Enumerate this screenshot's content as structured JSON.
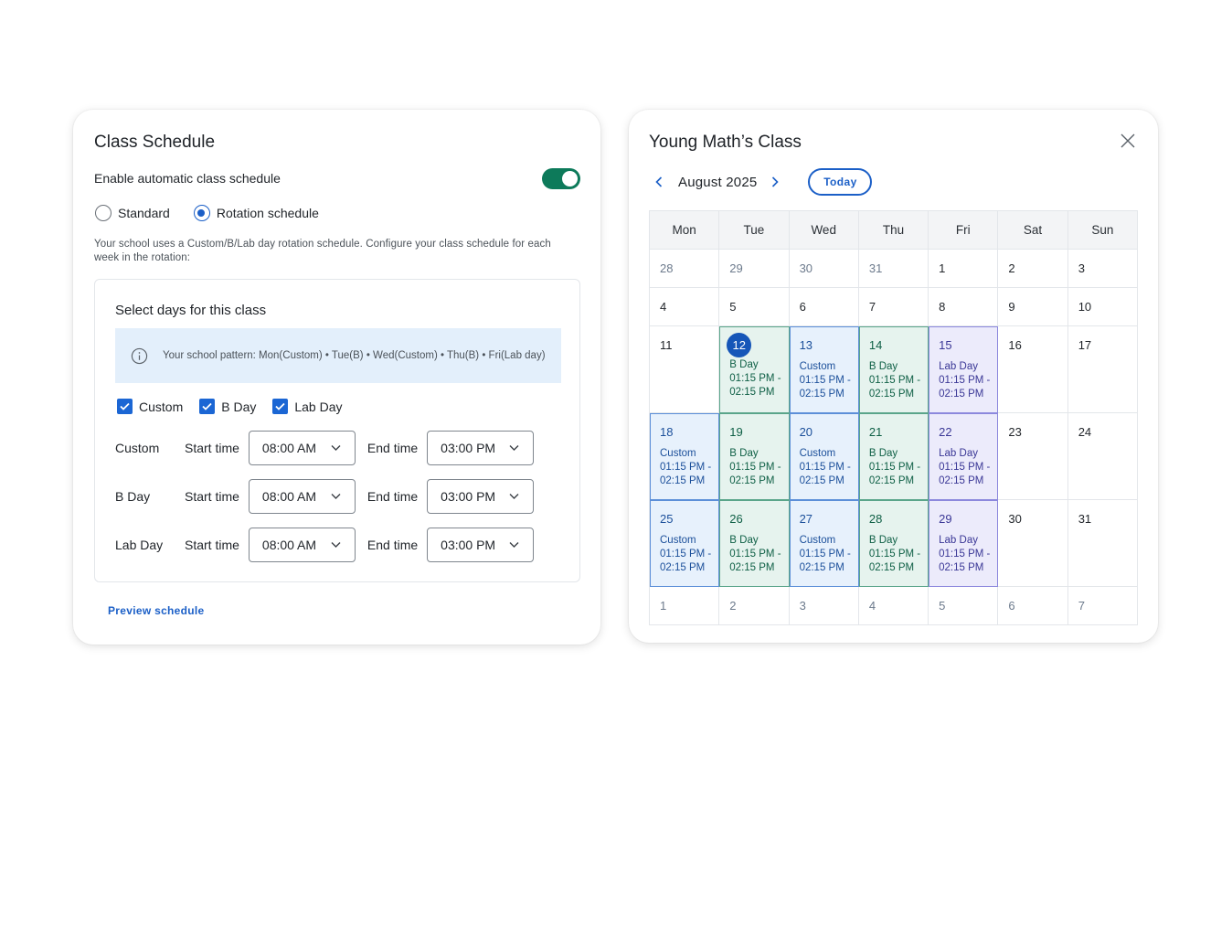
{
  "schedule": {
    "title": "Class Schedule",
    "toggle_label": "Enable automatic class schedule",
    "toggle_on": true,
    "radios": [
      {
        "label": "Standard",
        "checked": false
      },
      {
        "label": "Rotation schedule",
        "checked": true
      }
    ],
    "help_text": "Your school uses a Custom/B/Lab day rotation schedule. Configure your class schedule for each week in the rotation:",
    "panel_title": "Select days for this class",
    "info_text": "Your school pattern: Mon(Custom) • Tue(B) • Wed(Custom) • Thu(B) • Fri(Lab day)",
    "checkboxes": [
      {
        "label": "Custom",
        "checked": true
      },
      {
        "label": "B Day",
        "checked": true
      },
      {
        "label": "Lab Day",
        "checked": true
      }
    ],
    "rows": [
      {
        "day": "Custom",
        "start_label": "Start time",
        "start": "08:00 AM",
        "end_label": "End time",
        "end": "03:00 PM"
      },
      {
        "day": "B Day",
        "start_label": "Start time",
        "start": "08:00 AM",
        "end_label": "End time",
        "end": "03:00 PM"
      },
      {
        "day": "Lab Day",
        "start_label": "Start time",
        "start": "08:00 AM",
        "end_label": "End time",
        "end": "03:00 PM"
      }
    ],
    "preview_link": "Preview schedule"
  },
  "calendar": {
    "title": "Young Math’s Class",
    "month": "August 2025",
    "today_label": "Today",
    "weekdays": [
      "Mon",
      "Tue",
      "Wed",
      "Thu",
      "Fri",
      "Sat",
      "Sun"
    ],
    "weeks": [
      [
        {
          "d": "28",
          "m": true
        },
        {
          "d": "29",
          "m": true
        },
        {
          "d": "30",
          "m": true
        },
        {
          "d": "31",
          "m": true
        },
        {
          "d": "1"
        },
        {
          "d": "2"
        },
        {
          "d": "3"
        }
      ],
      [
        {
          "d": "4"
        },
        {
          "d": "5"
        },
        {
          "d": "6"
        },
        {
          "d": "7"
        },
        {
          "d": "8"
        },
        {
          "d": "9"
        },
        {
          "d": "10"
        }
      ],
      [
        {
          "d": "11"
        },
        {
          "d": "12",
          "t": "bday",
          "today": true,
          "label": "B Day",
          "time": "01:15 PM - 02:15 PM"
        },
        {
          "d": "13",
          "t": "custom",
          "label": "Custom",
          "time": "01:15 PM - 02:15 PM"
        },
        {
          "d": "14",
          "t": "bday",
          "label": "B Day",
          "time": "01:15 PM - 02:15 PM"
        },
        {
          "d": "15",
          "t": "lab",
          "label": "Lab Day",
          "time": "01:15 PM - 02:15 PM"
        },
        {
          "d": "16"
        },
        {
          "d": "17"
        }
      ],
      [
        {
          "d": "18",
          "t": "custom",
          "label": "Custom",
          "time": "01:15 PM - 02:15 PM"
        },
        {
          "d": "19",
          "t": "bday",
          "label": "B Day",
          "time": "01:15 PM - 02:15 PM"
        },
        {
          "d": "20",
          "t": "custom",
          "label": "Custom",
          "time": "01:15 PM - 02:15 PM"
        },
        {
          "d": "21",
          "t": "bday",
          "label": "B Day",
          "time": "01:15 PM - 02:15 PM"
        },
        {
          "d": "22",
          "t": "lab",
          "label": "Lab Day",
          "time": "01:15 PM - 02:15 PM"
        },
        {
          "d": "23"
        },
        {
          "d": "24"
        }
      ],
      [
        {
          "d": "25",
          "t": "custom",
          "label": "Custom",
          "time": "01:15 PM - 02:15 PM"
        },
        {
          "d": "26",
          "t": "bday",
          "label": "B Day",
          "time": "01:15 PM - 02:15 PM"
        },
        {
          "d": "27",
          "t": "custom",
          "label": "Custom",
          "time": "01:15 PM - 02:15 PM"
        },
        {
          "d": "28",
          "t": "bday",
          "label": "B Day",
          "time": "01:15 PM - 02:15 PM"
        },
        {
          "d": "29",
          "t": "lab",
          "label": "Lab Day",
          "time": "01:15 PM - 02:15 PM"
        },
        {
          "d": "30"
        },
        {
          "d": "31"
        }
      ],
      [
        {
          "d": "1",
          "m": true
        },
        {
          "d": "2",
          "m": true
        },
        {
          "d": "3",
          "m": true
        },
        {
          "d": "4",
          "m": true
        },
        {
          "d": "5",
          "m": true
        },
        {
          "d": "6",
          "m": true
        },
        {
          "d": "7",
          "m": true
        }
      ]
    ]
  },
  "colors": {
    "accent": "#1b5fc7",
    "toggle_on": "#0d7a5a",
    "custom_bg": "#e7f1fc",
    "bday_bg": "#e6f3ee",
    "lab_bg": "#ecebfb"
  },
  "icons": [
    "info-icon",
    "check-icon",
    "chevron-down-icon",
    "close-icon",
    "chevron-left-icon",
    "chevron-right-icon"
  ]
}
